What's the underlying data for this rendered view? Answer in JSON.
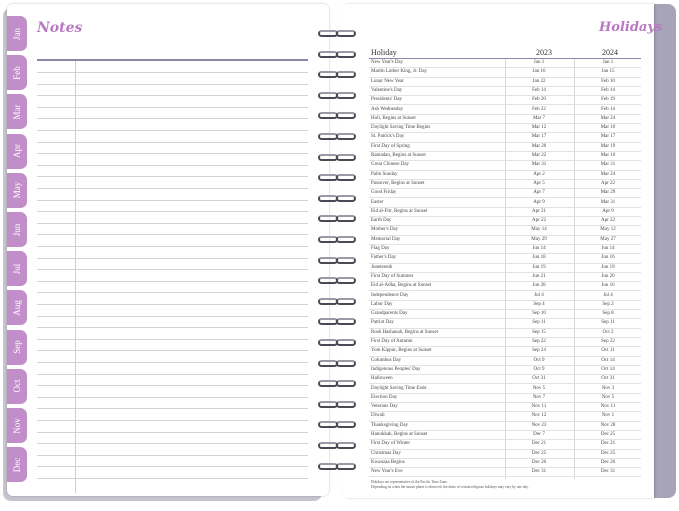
{
  "notes": {
    "title": "Notes"
  },
  "month_tabs": [
    "Jan",
    "Feb",
    "Mar",
    "Apr",
    "May",
    "Jun",
    "Jul",
    "Aug",
    "Sep",
    "Oct",
    "Nov",
    "Dec"
  ],
  "holidays": {
    "title": "Holidays",
    "columns": [
      "Holiday",
      "2023",
      "2024"
    ],
    "rows": [
      [
        "New Year's Day",
        "Jan 1",
        "Jan 1"
      ],
      [
        "Martin Luther King, Jr. Day",
        "Jan 16",
        "Jan 15"
      ],
      [
        "Lunar New Year",
        "Jan 22",
        "Feb 10"
      ],
      [
        "Valentine's Day",
        "Feb 14",
        "Feb 14"
      ],
      [
        "Presidents' Day",
        "Feb 20",
        "Feb 19"
      ],
      [
        "Ash Wednesday",
        "Feb 22",
        "Feb 14"
      ],
      [
        "Holi, Begins at Sunset",
        "Mar 7",
        "Mar 24"
      ],
      [
        "Daylight Saving Time Begins",
        "Mar 12",
        "Mar 10"
      ],
      [
        "St. Patrick's Day",
        "Mar 17",
        "Mar 17"
      ],
      [
        "First Day of Spring",
        "Mar 20",
        "Mar 19"
      ],
      [
        "Ramadan, Begins at Sunset",
        "Mar 22",
        "Mar 10"
      ],
      [
        "Great Chinese Day",
        "Mar 31",
        "Mar 31"
      ],
      [
        "Palm Sunday",
        "Apr 2",
        "Mar 24"
      ],
      [
        "Passover, Begins at Sunset",
        "Apr 5",
        "Apr 22"
      ],
      [
        "Good Friday",
        "Apr 7",
        "Mar 29"
      ],
      [
        "Easter",
        "Apr 9",
        "Mar 31"
      ],
      [
        "Eid al-Fitr, Begins at Sunset",
        "Apr 21",
        "Apr 9"
      ],
      [
        "Earth Day",
        "Apr 22",
        "Apr 22"
      ],
      [
        "Mother's Day",
        "May 14",
        "May 12"
      ],
      [
        "Memorial Day",
        "May 29",
        "May 27"
      ],
      [
        "Flag Day",
        "Jun 14",
        "Jun 14"
      ],
      [
        "Father's Day",
        "Jun 18",
        "Jun 16"
      ],
      [
        "Juneteenth",
        "Jun 19",
        "Jun 19"
      ],
      [
        "First Day of Summer",
        "Jun 21",
        "Jun 20"
      ],
      [
        "Eid al-Adha, Begins at Sunset",
        "Jun 28",
        "Jun 16"
      ],
      [
        "Independence Day",
        "Jul 4",
        "Jul 4"
      ],
      [
        "Labor Day",
        "Sep 4",
        "Sep 2"
      ],
      [
        "Grandparents Day",
        "Sep 10",
        "Sep 8"
      ],
      [
        "Patriot Day",
        "Sep 11",
        "Sep 11"
      ],
      [
        "Rosh Hashanah, Begins at Sunset",
        "Sep 15",
        "Oct 2"
      ],
      [
        "First Day of Autumn",
        "Sep 22",
        "Sep 22"
      ],
      [
        "Yom Kippur, Begins at Sunset",
        "Sep 24",
        "Oct 11"
      ],
      [
        "Columbus Day",
        "Oct 9",
        "Oct 14"
      ],
      [
        "Indigenous Peoples' Day",
        "Oct 9",
        "Oct 14"
      ],
      [
        "Halloween",
        "Oct 31",
        "Oct 31"
      ],
      [
        "Daylight Saving Time Ends",
        "Nov 5",
        "Nov 3"
      ],
      [
        "Election Day",
        "Nov 7",
        "Nov 5"
      ],
      [
        "Veterans Day",
        "Nov 11",
        "Nov 11"
      ],
      [
        "Diwali",
        "Nov 12",
        "Nov 1"
      ],
      [
        "Thanksgiving Day",
        "Nov 23",
        "Nov 28"
      ],
      [
        "Hanukkah, Begins at Sunset",
        "Dec 7",
        "Dec 25"
      ],
      [
        "First Day of Winter",
        "Dec 21",
        "Dec 21"
      ],
      [
        "Christmas Day",
        "Dec 25",
        "Dec 25"
      ],
      [
        "Kwanzaa Begins",
        "Dec 26",
        "Dec 26"
      ],
      [
        "New Year's Eve",
        "Dec 31",
        "Dec 31"
      ]
    ],
    "footnotes": [
      "Holidays are representative of the Pacific Time Zone.",
      "Depending on when the sunset phase is observed, the dates of certain religious holidays may vary by one day."
    ]
  },
  "colors": {
    "accent": "#b879c2",
    "tab": "#c28ec9",
    "cover": "#a7a4b8",
    "rule": "#8d86a8"
  }
}
